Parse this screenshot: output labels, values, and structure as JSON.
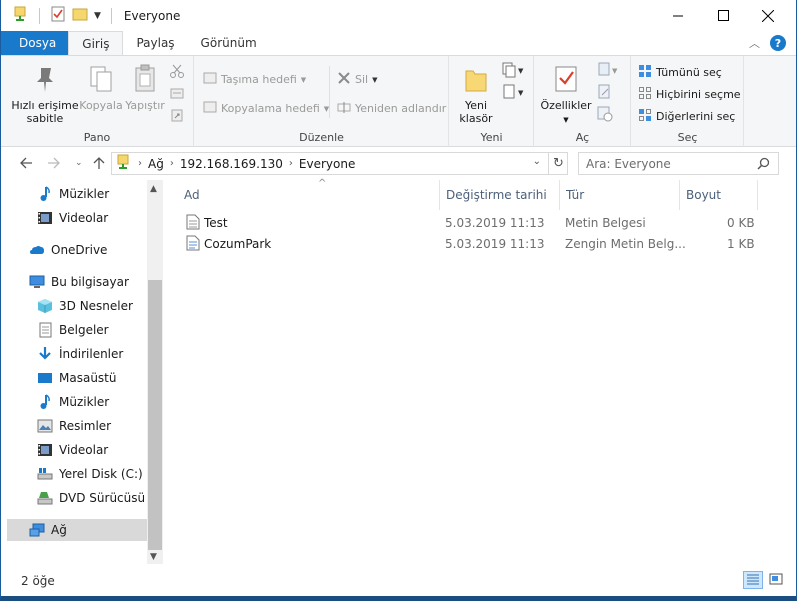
{
  "window": {
    "title": "Everyone"
  },
  "tabs": {
    "file": "Dosya",
    "home": "Giriş",
    "share": "Paylaş",
    "view": "Görünüm"
  },
  "ribbon": {
    "clipboard": {
      "label": "Pano",
      "pin": "Hızlı erişime sabitle",
      "copy": "Kopyala",
      "paste": "Yapıştır"
    },
    "organize": {
      "label": "Düzenle",
      "move_to": "Taşıma hedefi",
      "copy_to": "Kopyalama hedefi",
      "delete": "Sil",
      "rename": "Yeniden adlandır"
    },
    "new": {
      "label": "Yeni",
      "new_folder": "Yeni klasör"
    },
    "open": {
      "label": "Aç",
      "properties": "Özellikler"
    },
    "select": {
      "label": "Seç",
      "select_all": "Tümünü seç",
      "select_none": "Hiçbirini seçme",
      "invert": "Diğerlerini seç"
    }
  },
  "address": {
    "crumbs": [
      "Ağ",
      "192.168.169.130",
      "Everyone"
    ],
    "search_placeholder": "Ara: Everyone"
  },
  "sidebar": {
    "items": [
      {
        "label": "Müzikler",
        "icon": "music-icon"
      },
      {
        "label": "Videolar",
        "icon": "video-icon"
      },
      {
        "label": "OneDrive",
        "icon": "onedrive-icon"
      },
      {
        "label": "Bu bilgisayar",
        "icon": "computer-icon"
      },
      {
        "label": "3D Nesneler",
        "icon": "3d-objects-icon"
      },
      {
        "label": "Belgeler",
        "icon": "documents-icon"
      },
      {
        "label": "İndirilenler",
        "icon": "downloads-icon"
      },
      {
        "label": "Masaüstü",
        "icon": "desktop-icon"
      },
      {
        "label": "Müzikler",
        "icon": "music-icon"
      },
      {
        "label": "Resimler",
        "icon": "pictures-icon"
      },
      {
        "label": "Videolar",
        "icon": "video-icon"
      },
      {
        "label": "Yerel Disk (C:)",
        "icon": "local-disk-icon"
      },
      {
        "label": "DVD Sürücüsü (D",
        "icon": "dvd-drive-icon"
      },
      {
        "label": "Ağ",
        "icon": "network-icon"
      }
    ]
  },
  "columns": {
    "name": "Ad",
    "date": "Değiştirme tarihi",
    "type": "Tür",
    "size": "Boyut"
  },
  "files": [
    {
      "name": "Test",
      "date": "5.03.2019 11:13",
      "type": "Metin Belgesi",
      "size": "0 KB"
    },
    {
      "name": "CozumPark",
      "date": "5.03.2019 11:13",
      "type": "Zengin Metin Belg...",
      "size": "1 KB"
    }
  ],
  "status": {
    "count": "2 öğe"
  },
  "colors": {
    "accent": "#1979ca",
    "selection": "#d9d9d9",
    "header_text": "#4c607a"
  }
}
